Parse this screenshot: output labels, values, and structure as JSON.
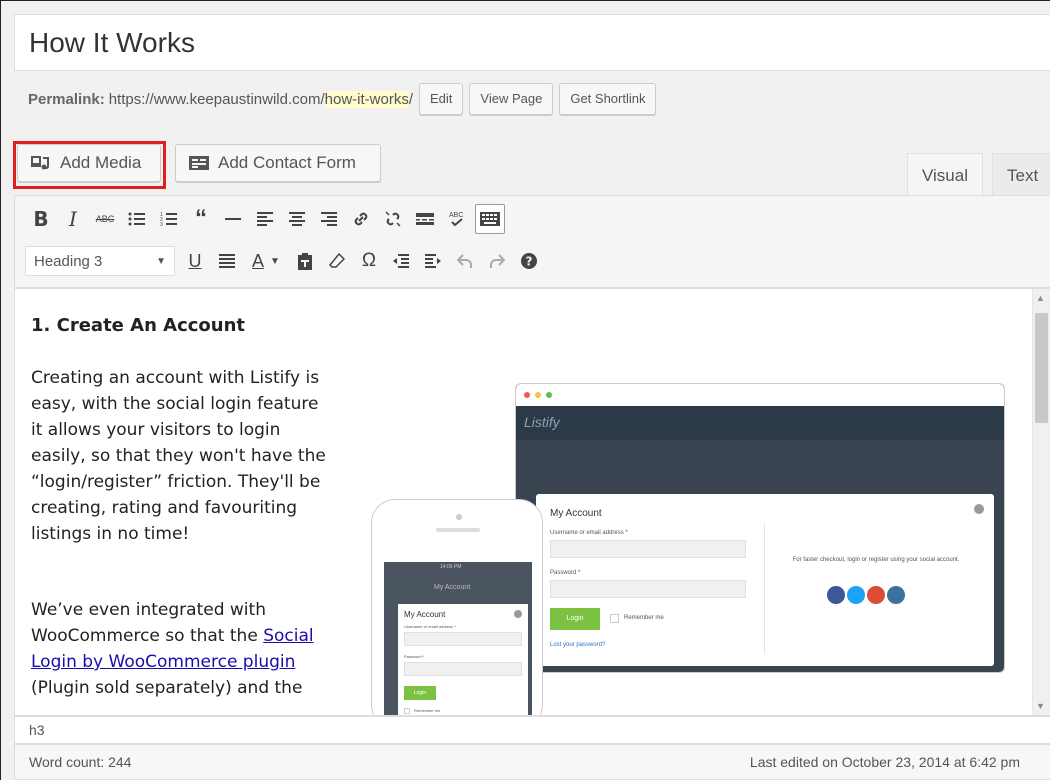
{
  "title": "How It Works",
  "permalink": {
    "label": "Permalink:",
    "base_url": "https://www.keepaustinwild.com/",
    "slug": "how-it-works",
    "trail": "/",
    "buttons": [
      "Edit",
      "View Page",
      "Get Shortlink"
    ]
  },
  "media_buttons": {
    "add_media": "Add Media",
    "add_contact_form": "Add Contact Form"
  },
  "tabs": [
    "Visual",
    "Text"
  ],
  "toolbar": {
    "format_select": "Heading 3",
    "row1_icons": [
      "bold-icon",
      "italic-icon",
      "strikethrough-icon",
      "bullet-list-icon",
      "numbered-list-icon",
      "blockquote-icon",
      "horizontal-rule-icon",
      "align-left-icon",
      "align-center-icon",
      "align-right-icon",
      "link-icon",
      "unlink-icon",
      "read-more-icon",
      "spellcheck-icon",
      "toolbar-toggle-icon"
    ],
    "row2_icons": [
      "underline-icon",
      "justify-icon",
      "text-color-icon",
      "paste-text-icon",
      "clear-formatting-icon",
      "special-character-icon",
      "outdent-icon",
      "indent-icon",
      "undo-icon",
      "redo-icon",
      "help-icon"
    ]
  },
  "content": {
    "heading": "1. Create An Account",
    "paragraph1": "Creating an account with Listify is easy, with the social login feature it allows your visitors to login easily, so that they won't have the “login/register” friction. They'll be creating, rating and favouriting listings in no time!",
    "paragraph2_pre": "We’ve even integrated with WooCommerce so that the ",
    "paragraph2_link": "Social Login by WooCommerce plugin",
    "paragraph2_post": " (Plugin sold separately) and the",
    "illustration": {
      "browser_logo": "Listify",
      "modal_title": "My Account",
      "username_label": "Username or email address *",
      "password_label": "Password *",
      "login_button": "Login",
      "remember_label": "Remember me",
      "lost_password": "Lost your password?",
      "social_text": "For faster checkout, login or register using your social account.",
      "phone_time": "14:06 PM",
      "phone_header": "My Account",
      "phone_modal_title": "My Account"
    }
  },
  "path": "h3",
  "status": {
    "word_count": "Word count: 244",
    "last_edited": "Last edited on October 23, 2014 at 6:42 pm"
  },
  "colors": {
    "highlight_border": "#e02020",
    "slug_bg": "#fffbcc",
    "link": "#1a0dab",
    "login_green": "#7cc242"
  }
}
